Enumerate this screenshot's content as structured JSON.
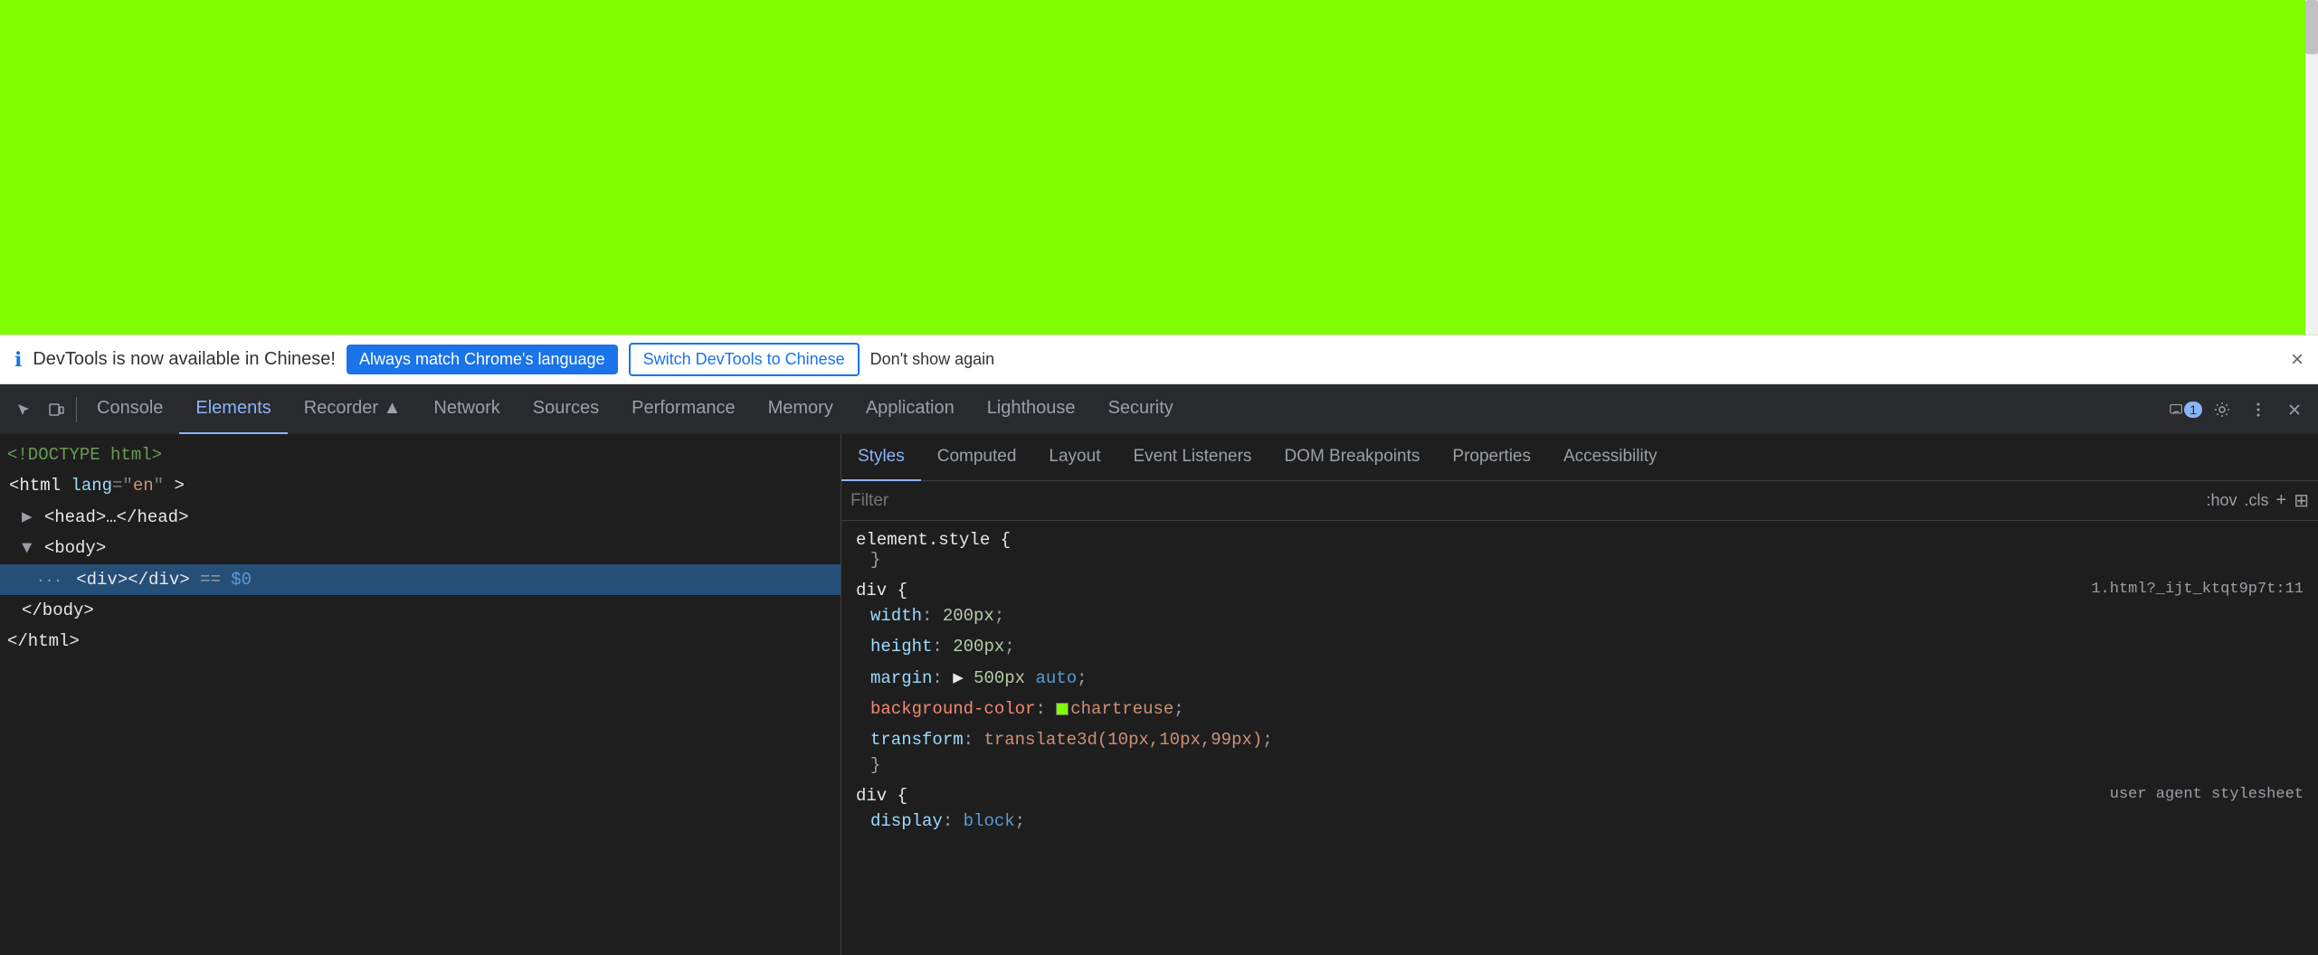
{
  "page": {
    "background_color": "#7fff00"
  },
  "notification": {
    "icon": "ℹ",
    "text": "DevTools is now available in Chinese!",
    "btn1_label": "Always match Chrome's language",
    "btn2_label": "Switch DevTools to Chinese",
    "btn3_label": "Don't show again",
    "close_label": "×"
  },
  "devtools_tabs": {
    "icons": [
      "cursor-icon",
      "mobile-icon",
      "console-icon"
    ],
    "tabs": [
      {
        "label": "Console",
        "active": false
      },
      {
        "label": "Elements",
        "active": true
      },
      {
        "label": "Recorder ▲",
        "active": false
      },
      {
        "label": "Network",
        "active": false
      },
      {
        "label": "Sources",
        "active": false
      },
      {
        "label": "Performance",
        "active": false
      },
      {
        "label": "Memory",
        "active": false
      },
      {
        "label": "Application",
        "active": false
      },
      {
        "label": "Lighthouse",
        "active": false
      },
      {
        "label": "Security",
        "active": false
      }
    ],
    "right_icons": [
      "chat-icon",
      "settings-icon",
      "more-icon",
      "close-icon"
    ],
    "chat_badge": "1"
  },
  "dom_tree": {
    "lines": [
      {
        "indent": 0,
        "content": "<!DOCTYPE html>",
        "type": "comment"
      },
      {
        "indent": 0,
        "content": "<html lang=\"en\">",
        "type": "tag"
      },
      {
        "indent": 1,
        "content": "▶ <head>…</head>",
        "type": "tag"
      },
      {
        "indent": 1,
        "content": "▼ <body>",
        "type": "tag"
      },
      {
        "indent": 2,
        "content": "<div></div>  == $0",
        "type": "selected"
      },
      {
        "indent": 1,
        "content": "</body>",
        "type": "tag"
      },
      {
        "indent": 0,
        "content": "</html>",
        "type": "tag"
      }
    ]
  },
  "styles_panel": {
    "tabs": [
      {
        "label": "Styles",
        "active": true
      },
      {
        "label": "Computed",
        "active": false
      },
      {
        "label": "Layout",
        "active": false
      },
      {
        "label": "Event Listeners",
        "active": false
      },
      {
        "label": "DOM Breakpoints",
        "active": false
      },
      {
        "label": "Properties",
        "active": false
      },
      {
        "label": "Accessibility",
        "active": false
      }
    ],
    "filter": {
      "placeholder": "Filter",
      "hov_label": ":hov",
      "cls_label": ".cls",
      "plus_label": "+",
      "panel_label": "⊞"
    },
    "blocks": [
      {
        "selector": "element.style {",
        "props": [],
        "closing": "}",
        "source": ""
      },
      {
        "selector": "div {",
        "props": [
          {
            "name": "width",
            "value": "200px",
            "type": "num"
          },
          {
            "name": "height",
            "value": "200px",
            "type": "num"
          },
          {
            "name": "margin",
            "value": "▶ 500px auto",
            "type": "mixed"
          },
          {
            "name": "background-color",
            "value": "chartreuse",
            "type": "color",
            "swatch": "#7fff00"
          },
          {
            "name": "transform",
            "value": "translate3d(10px,10px,99px)",
            "type": "text"
          }
        ],
        "closing": "}",
        "source": "1.html?_ijt_ktqt9p7t:11"
      },
      {
        "selector": "div {",
        "props": [
          {
            "name": "display",
            "value": "block",
            "type": "keyword"
          }
        ],
        "closing": "",
        "source": "user agent stylesheet"
      }
    ]
  }
}
